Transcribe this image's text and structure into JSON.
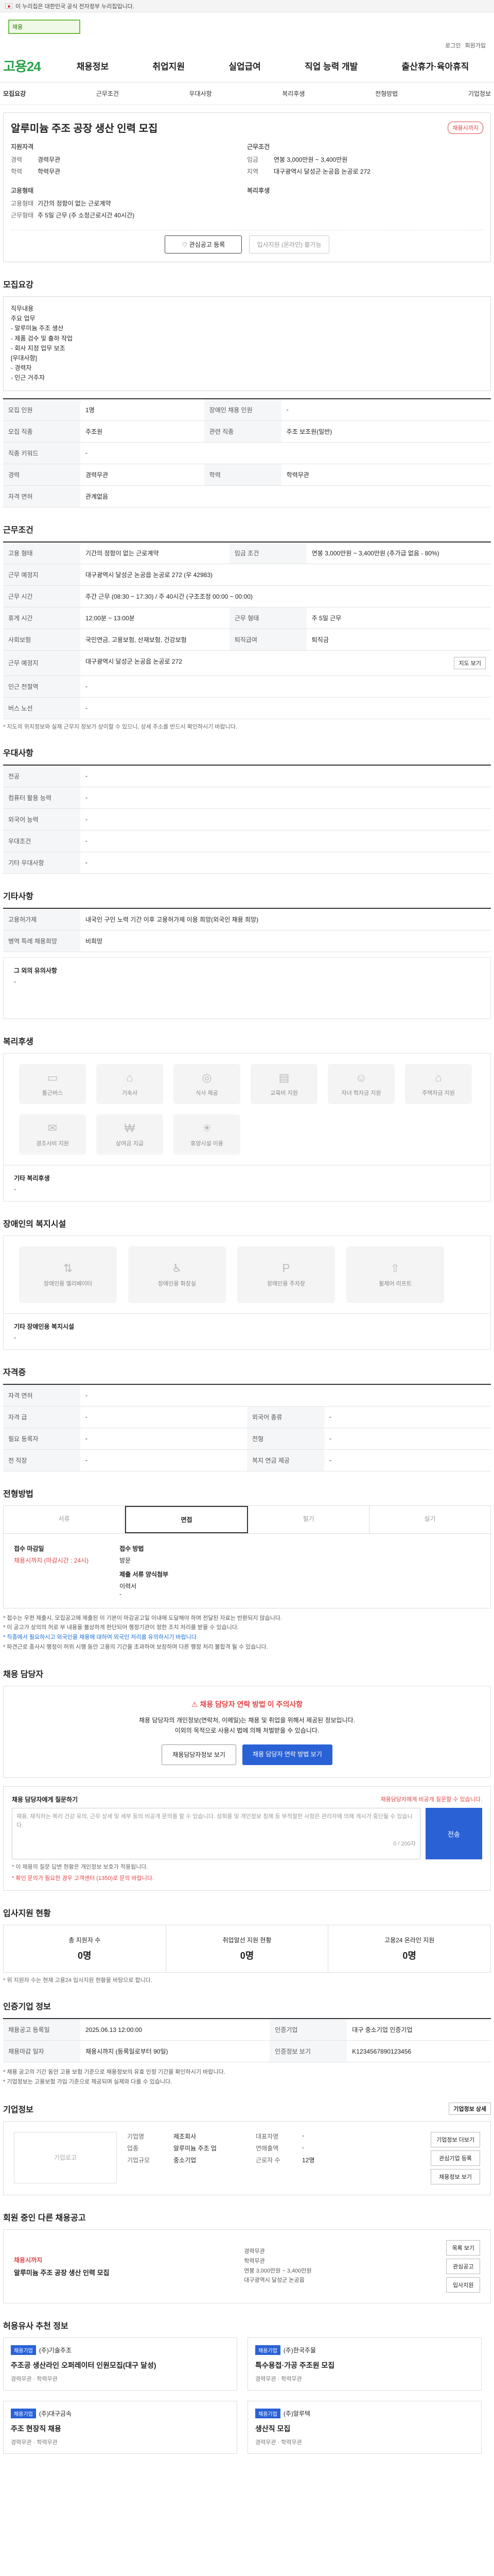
{
  "gov_notice": "이 누리집은 대한민국 공식 전자정부 누리집입니다.",
  "header": {
    "search_placeholder": "채용",
    "util_links": [
      "로그인",
      "회원가입"
    ],
    "logo_main": "고용",
    "logo_num": "24",
    "gnb": [
      "채용정보",
      "취업지원",
      "실업급여",
      "직업 능력 개발",
      "출산휴가·육아휴직"
    ]
  },
  "subtabs": [
    "모집요강",
    "근무조건",
    "우대사항",
    "복리후생",
    "전형방법",
    "기업정보"
  ],
  "job": {
    "title": "알루미늄 주조 공장 생산 인력 모집",
    "badge": "채용시까지",
    "left_title": "지원자격",
    "left": [
      {
        "k": "경력",
        "v": "경력무관"
      },
      {
        "k": "학력",
        "v": "학력무관"
      }
    ],
    "right_title": "근무조건",
    "right": [
      {
        "k": "임금",
        "v": "연봉 3,000만원 ~ 3,400만원"
      },
      {
        "k": "지역",
        "v": "대구광역시 달성군 논공읍 논공로 272"
      }
    ],
    "left2_title": "고용형태",
    "left2": [
      {
        "k": "고용형태",
        "v": "기간의 정함이 없는 근로계약"
      },
      {
        "k": "근무형태",
        "v": "주 5일 근무 (주 소정근로시간 40시간)"
      }
    ],
    "right2_title": "복리후생",
    "btn_scrap": "관심공고 등록",
    "btn_apply": "입사지원 (온라인) 불가능"
  },
  "sections": {
    "recruit": "모집요강",
    "work": "근무조건",
    "pref": "우대사항",
    "other": "기타사항",
    "welfare": "복리후생",
    "disabled": "장애인의 복지시설",
    "certs": "자격증",
    "method": "전형방법",
    "contact": "채용 담당자",
    "stats": "입사지원 현황",
    "reg": "인증기업 정보",
    "company": "기업정보",
    "other_jobs": "회원 중인 다른 채용공고",
    "similar": "허용유사 추천 정보"
  },
  "recruit_text": [
    "직무내용",
    "",
    "주요 업무",
    "- 알루미늄 주조 생산",
    "- 제품 검수 및 출하 작업",
    "- 회사 지정 업무 보조",
    "",
    "[우대사항]",
    "- 경력자",
    "- 인근 거주자"
  ],
  "recruit_table": [
    {
      "k": "모집 인원",
      "v": "1명",
      "k2": "장애인 채용 인원",
      "v2": "-"
    },
    {
      "k": "모집 직종",
      "v": "주조원",
      "k2": "관련 직종",
      "v2": "주조 보조원(일반)"
    },
    {
      "k": "직종 키워드",
      "v": "-",
      "k2": "",
      "v2": ""
    },
    {
      "k": "경력",
      "v": "경력무관",
      "k2": "학력",
      "v2": "학력무관"
    },
    {
      "k": "자격 면허",
      "v": "관계없음",
      "k2": "",
      "v2": ""
    }
  ],
  "work_table": [
    {
      "k": "고용 형태",
      "v": "기간의 정함이 없는 근로계약",
      "k2": "임금 조건",
      "v2": "연봉 3,000만원 ~ 3,400만원 (추가급 없음 - 80%)"
    },
    {
      "k": "근무 예정지",
      "v": "대구광역시 달성군 논공읍 논공로 272 (우 42983)",
      "k2": "",
      "v2": ""
    },
    {
      "k": "근무 시간",
      "v": "주간 근무 (08:30 ~ 17:30) / 주 40시간 (구조조정 00:00 ~ 00:00)",
      "k2": "",
      "v2": ""
    },
    {
      "k": "휴게 시간",
      "v": "12:00분 ~ 13:00분",
      "k2": "근무 형태",
      "v2": "주 5일 근무"
    },
    {
      "k": "사회보험",
      "v": "국민연금, 고용보험, 산재보험, 건강보험",
      "k2": "퇴직급여",
      "v2": "퇴직금"
    },
    {
      "k": "근무 예정지",
      "v": "대구광역시 달성군 논공읍 논공로 272",
      "k2": "",
      "v2": ""
    },
    {
      "k": "인근 전철역",
      "v": "-",
      "k2": "",
      "v2": ""
    },
    {
      "k": "버스 노선",
      "v": "-",
      "k2": "",
      "v2": ""
    }
  ],
  "work_note": "* 지도의 위치정보와 실제 근무지 정보가 상이할 수 있으니, 상세 주소를 반드시 확인하시기 바랍니다.",
  "work_map_btn": "지도 보기",
  "pref_table": [
    {
      "k": "전공",
      "v": "-"
    },
    {
      "k": "컴퓨터 활용 능력",
      "v": "-"
    },
    {
      "k": "외국어 능력",
      "v": "-"
    },
    {
      "k": "우대조건",
      "v": "-"
    },
    {
      "k": "기타 우대사항",
      "v": "-"
    }
  ],
  "other_table": [
    {
      "k": "고용허가제",
      "v": "내국인 구인 노력 기간 이후 고용허가제 이용 희망(외국인 채용 희망)"
    },
    {
      "k": "병역 특례 채용희망",
      "v": "비희망"
    }
  ],
  "other_text_label": "그 외의 유의사항",
  "other_text": "-",
  "welfare_icons": [
    "통근버스",
    "기숙사",
    "식사 제공",
    "교육비 지원",
    "자녀 학자금 지원",
    "주택자금 지원",
    "경조사비 지원",
    "상여금 지급",
    "휴양시설 이용"
  ],
  "welfare_other_label": "기타 복리후생",
  "welfare_other": "-",
  "disabled_icons": [
    "장애인용 엘리베이터",
    "장애인용 화장실",
    "장애인용 주차장",
    "휠체어 리프트"
  ],
  "disabled_other_label": "기타 장애인용 복지시설",
  "disabled_other": "-",
  "certs_table": [
    {
      "k": "자격 면허",
      "v": "-",
      "k2": "",
      "v2": ""
    },
    {
      "k": "자격 급",
      "v": "-",
      "k2": "외국어 종류",
      "v2": "-"
    },
    {
      "k": "필요 등록자",
      "v": "-",
      "k2": "전형",
      "v2": "-"
    },
    {
      "k": "전 직장",
      "v": "-",
      "k2": "복지 연금 제공",
      "v2": "-"
    }
  ],
  "method_tabs": [
    "서류",
    "면접",
    "필기",
    "실기"
  ],
  "method_on": 1,
  "method": {
    "deadline_label": "접수 마감일",
    "deadline": "채용시까지 (마감시간 : 24시)",
    "way_label": "접수 방법",
    "way": "방문",
    "docs_label": "제출 서류 양식첨부",
    "docs": "이력서",
    "docs2": "-"
  },
  "method_bullets": [
    "* 접수는 우편 제출시, 모집공고에 제출된 이 기본이 마감공고일 이내에 도달해야 하며 전달된 자료는 반환되지 않습니다.",
    "* 이 공고가 상의의 허로 부 내용을 불상하게 판단되어 행정기관이 정한 조치 처리를 받을 수 있습니다.",
    "* 직종에서 필요하시고 외국인을 채용에 대하여 외국인 처리를 유의하시기 바랍니다.",
    "* 파견근로 종사시 행정이 허위 시행 동안 고용의 기간을 초과하여 보장하며 다른 행정 처리 불합격 될 수 있습니다."
  ],
  "contact": {
    "alert_title": "채용 담당자 연락 방법 이 주의사항",
    "alert_lines": [
      "채용 담당자의 개인정보(연락처, 이메일)는 채용 및 취업을 위해서 제공된 정보입니다.",
      "이외의 목적으로 사용시 법에 의해 처벌받을 수 있습니다."
    ],
    "btn_view": "채용담당자정보 보기",
    "btn_contact": "채용 담당자 연락 방법 보기"
  },
  "inquiry": {
    "label": "채용 담당자에게 질문하기",
    "sub": "채용담당자에게 비공개 질문할 수 있습니다.",
    "placeholder": "채용, 재직하는 복리 건강 유의, 근무 상세 및 세부 등의 비공개 문의를 할 수 있습니다. 성희롱 및 개인정보 침해 등 부적절한 사항은 관리자에 의해 게시가 중단될 수 있습니다.",
    "count": "0 / 200자",
    "btn": "전송",
    "notes": [
      "* 이 채용의 질문 답변 현황은 개인정보 보호가 적용됩니다.",
      "* 확인 문의가 필요한 경우 고객센터 (1350)로 문의 바랍니다."
    ]
  },
  "stats": [
    {
      "label": "총 지원자 수",
      "value": "0명"
    },
    {
      "label": "취업알선 지원 현황",
      "value": "0명"
    },
    {
      "label": "고용24 온라인 지원",
      "value": "0명"
    }
  ],
  "stats_note": "* 위 지원자 수는 현재 고용24 입사지원 현황을 바탕으로 합니다.",
  "reg_table": [
    {
      "k": "채용공고 등록일",
      "v": "2025.06.13 12:00:00",
      "k2": "인증기업",
      "v2": "대구 중소기업 인증기업"
    },
    {
      "k": "채용마감 일자",
      "v": "채용시까지 (등록일로부터 90일)",
      "k2": "인증정보 보기",
      "v2": "K1234567890123456"
    }
  ],
  "reg_bullets": [
    "* 채용 공고의 기간 동안 고용 보험 기준으로 채용정보의 유효 인정 기간을 확인하시기 바랍니다.",
    "* 기업정보는 고용보험 가입 기준으로 제공되며 실제와 다를 수 있습니다."
  ],
  "company": {
    "logo_alt": "기업로고",
    "rows": [
      {
        "k": "기업명",
        "v": "제조회사",
        "k2": "대표자명",
        "v2": "-"
      },
      {
        "k": "업종",
        "v": "알루미늄 주조 업",
        "k2": "연매출액",
        "v2": "-"
      },
      {
        "k": "기업규모",
        "v": "중소기업",
        "k2": "근로자 수",
        "v2": "12명"
      }
    ],
    "btns": [
      "기업정보 더보기",
      "관심기업 등록",
      "채용정보 보기"
    ],
    "more_btn": "기업정보 상세"
  },
  "other_job": {
    "tag": "채용시까지",
    "title": "알루미늄 주조 공장 생산 인력 모집",
    "meta": [
      "경력무관",
      "학력무관",
      "연봉 3,000만원 ~ 3,400만원",
      "대구광역시 달성군 논공읍"
    ],
    "btns": [
      "목록 보기",
      "관심공고",
      "입사지원"
    ]
  },
  "similar_cards": [
    {
      "tag": "채용기업",
      "company": "(주)기술주조",
      "title": "주조공 생산라인 오퍼레이터 인원모집(대구 달성)",
      "meta": "경력무관 · 학력무관"
    },
    {
      "tag": "채용기업",
      "company": "(주)한국주물",
      "title": "특수용접·가공 주조원 모집",
      "meta": "경력무관 · 학력무관"
    },
    {
      "tag": "채용기업",
      "company": "(주)대구금속",
      "title": "주조 현장직 채용",
      "meta": "경력무관 · 학력무관"
    },
    {
      "tag": "채용기업",
      "company": "(주)알루텍",
      "title": "생산직 모집",
      "meta": "경력무관 · 학력무관"
    }
  ]
}
